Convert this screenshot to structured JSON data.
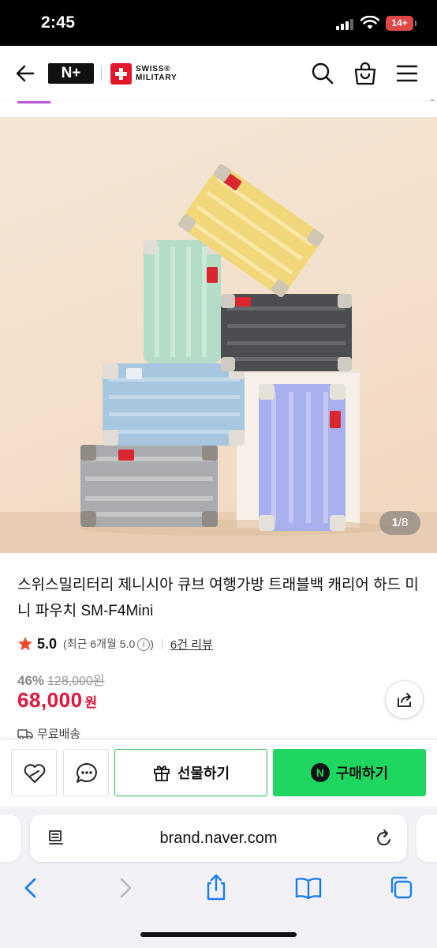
{
  "status_bar": {
    "time": "2:45",
    "battery": "14+"
  },
  "header": {
    "np_logo": "N+",
    "brand_logo_line1": "SWISS®",
    "brand_logo_line2": "MILITARY",
    "icons": [
      "back-icon",
      "search-icon",
      "shopping-bag-icon",
      "menu-icon"
    ]
  },
  "gallery": {
    "current": "1",
    "separator": "/",
    "total": "8"
  },
  "product": {
    "title": "스위스밀리터리 제니시아 큐브 여행가방 트래블백 캐리어 하드 미니 파우치 SM-F4Mini",
    "rating": "5.0",
    "rating_recent_prefix": "(최근 6개월 5.0",
    "rating_recent_suffix": ")",
    "info_glyph": "i",
    "review_link": "6건 리뷰",
    "discount_rate": "46%",
    "original_price": "128,000원",
    "sale_price": "68,000",
    "sale_unit": "원",
    "shipping": "무료배송"
  },
  "actions": {
    "gift_label": "선물하기",
    "buy_label": "구매하기",
    "npay_badge": "N"
  },
  "browser": {
    "url": "brand.naver.com"
  },
  "colors": {
    "sale_red": "#e0163b",
    "naver_green": "#1fd760",
    "gift_border": "#2dbf56",
    "brand_red": "#e3172a"
  }
}
